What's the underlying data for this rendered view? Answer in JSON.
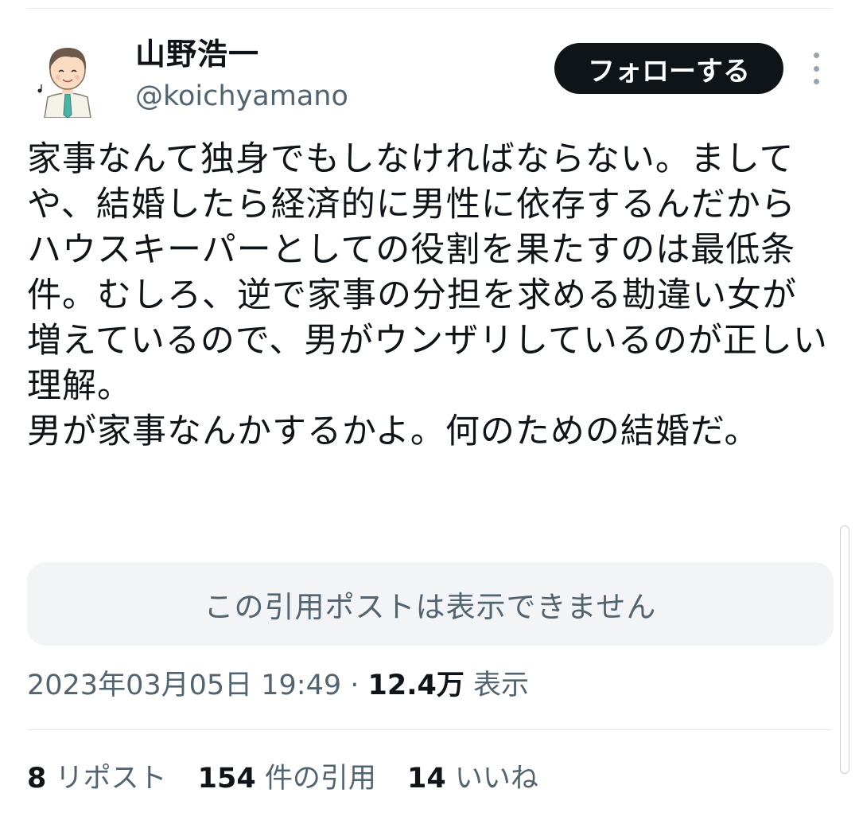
{
  "author": {
    "name": "山野浩一",
    "handle": "@koichyamano"
  },
  "follow_label": "フォローする",
  "tweet": {
    "lines": [
      "家事なんて独身でもしなければならない。ましてや、結婚したら経済的に男性に依存するんだからハウスキーパーとしての役割を果たすのは最低条件。むしろ、逆で家事の分担を求める勘違い女が増えているので、男がウンザリしているのが正しい理解。",
      "男が家事なんかするかよ。何のための結婚だ。"
    ]
  },
  "quote_unavailable": "この引用ポストは表示できません",
  "meta": {
    "timestamp": "2023年03月05日 19:49",
    "separator": " · ",
    "views_count": "12.4万",
    "views_label": " 表示"
  },
  "stats": [
    {
      "count": "8",
      "label": " リポスト"
    },
    {
      "count": "154",
      "label": " 件の引用"
    },
    {
      "count": "14",
      "label": " いいね"
    }
  ],
  "colors": {
    "text": "#0f1419",
    "secondary": "#536471",
    "button_bg": "#0f1419",
    "quote_bg": "#f2f4f5"
  }
}
